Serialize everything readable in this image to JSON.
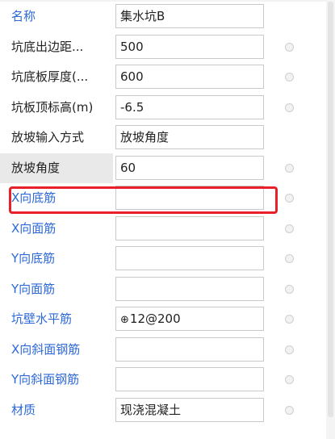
{
  "rows": [
    {
      "label": "名称",
      "value": "集水坑B",
      "blue": true,
      "dot": false
    },
    {
      "label": "坑底出边距...",
      "value": "500",
      "blue": false,
      "dot": true
    },
    {
      "label": "坑底板厚度(...",
      "value": "600",
      "blue": false,
      "dot": true
    },
    {
      "label": "坑板顶标高(m)",
      "value": "-6.5",
      "blue": false,
      "dot": true
    },
    {
      "label": "放坡输入方式",
      "value": "放坡角度",
      "blue": false,
      "dot": false
    },
    {
      "label": "放坡角度",
      "value": "60",
      "blue": false,
      "dot": true,
      "selected": true
    },
    {
      "label": "X向底筋",
      "value": "",
      "blue": true,
      "dot": true,
      "highlighted": true
    },
    {
      "label": "X向面筋",
      "value": "",
      "blue": true,
      "dot": true
    },
    {
      "label": "Y向底筋",
      "value": "",
      "blue": true,
      "dot": true
    },
    {
      "label": "Y向面筋",
      "value": "",
      "blue": true,
      "dot": true
    },
    {
      "label": "坑壁水平筋",
      "value": "12@200",
      "rebar_symbol": "⊕",
      "blue": true,
      "dot": true
    },
    {
      "label": "X向斜面钢筋",
      "value": "",
      "blue": true,
      "dot": true
    },
    {
      "label": "Y向斜面钢筋",
      "value": "",
      "blue": true,
      "dot": true
    },
    {
      "label": "材质",
      "value": "现浇混凝土",
      "blue": true,
      "dot": true
    }
  ],
  "colors": {
    "label_blue": "#2d68d8",
    "label_black": "#222222",
    "highlight_red": "#e8202a",
    "selected_bg": "#e9e9e9"
  }
}
